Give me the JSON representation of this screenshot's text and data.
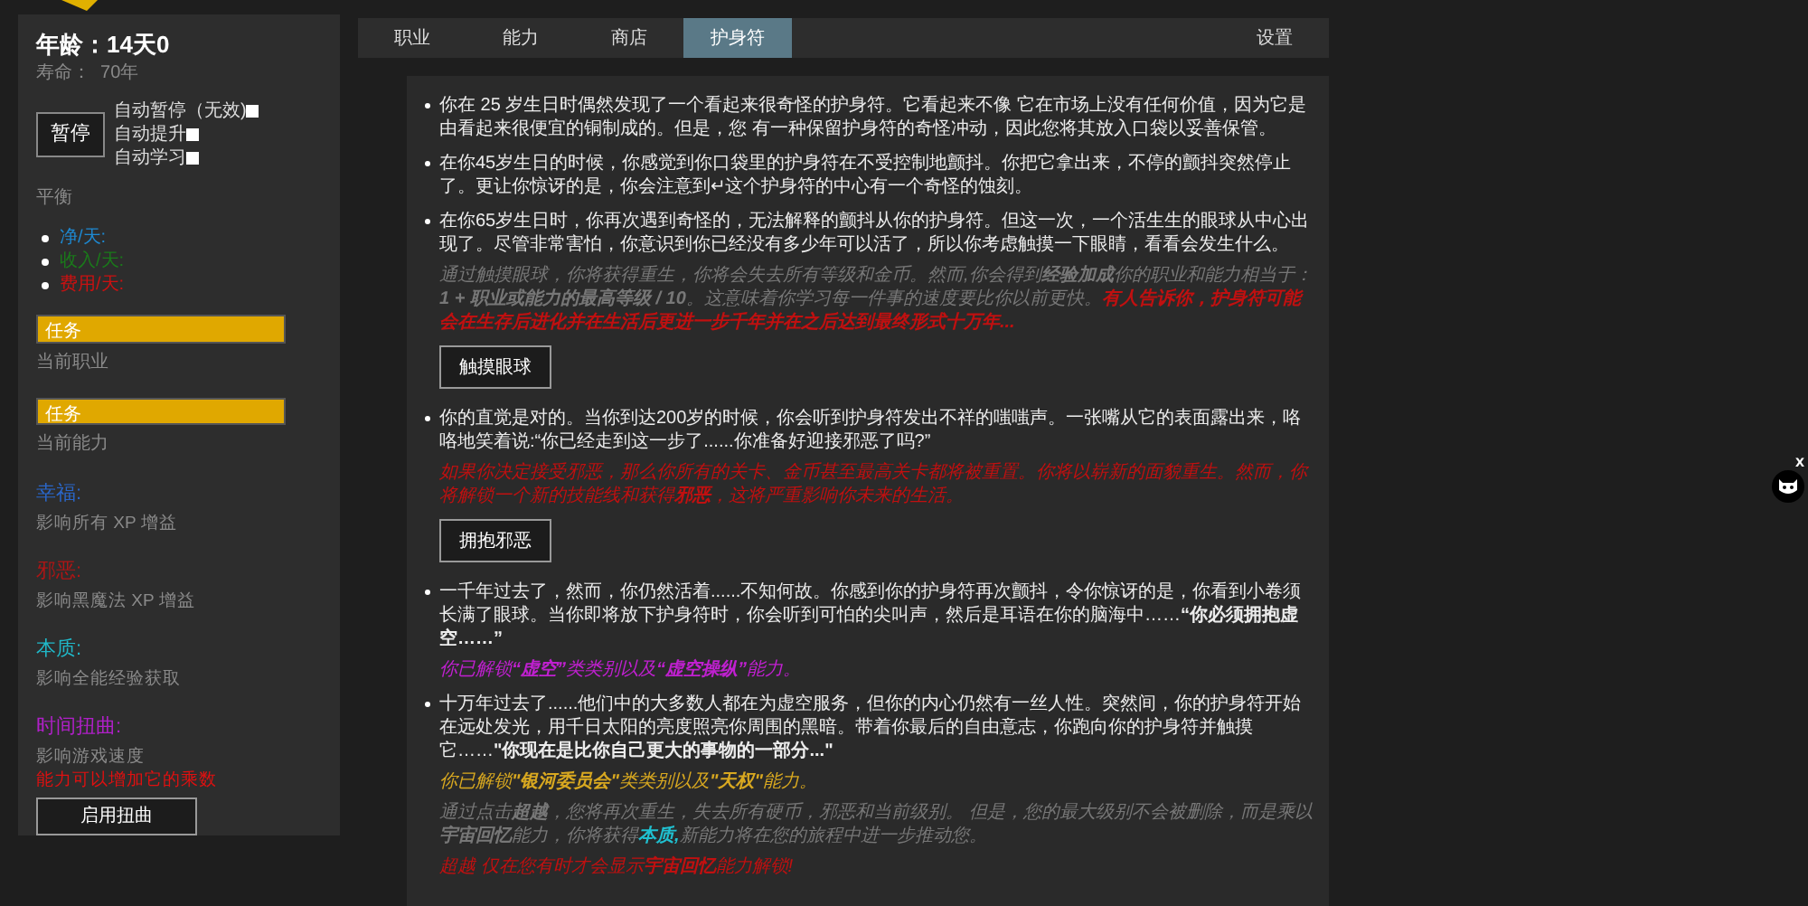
{
  "sidebar": {
    "age_label": "年龄：14天0",
    "lifespan": "寿命：  70年",
    "pause_button": "暂停",
    "toggles": [
      {
        "label": "自动暂停（无效)",
        "checked": false
      },
      {
        "label": "自动提升",
        "checked": false
      },
      {
        "label": "自动学习",
        "checked": false
      }
    ],
    "balance_label": "平衡",
    "balance_items": [
      {
        "label": "净/天:",
        "color": "#1e88d0"
      },
      {
        "label": "收入/天:",
        "color": "#1a7a1a"
      },
      {
        "label": "费用/天:",
        "color": "#cc1111"
      }
    ],
    "progress": [
      {
        "label": "任务",
        "level": 1,
        "caption": "当前职业"
      },
      {
        "label": "任务",
        "level": 1,
        "caption": "当前能力"
      }
    ],
    "stats": [
      {
        "name": "幸福:",
        "color": "#2a66c8",
        "description": "影响所有 XP 增益"
      },
      {
        "name": "邪恶:",
        "color": "#b01515",
        "description": "影响黑魔法 XP 增益"
      },
      {
        "name": "本质:",
        "color": "#20b8c8",
        "description": "影响全能经验获取"
      },
      {
        "name": "时间扭曲:",
        "color": "#b020c8",
        "description": "影响游戏速度",
        "warning": "能力可以增加它的乘数"
      }
    ],
    "warp_button": "启用扭曲"
  },
  "tabs": [
    {
      "label": "职业",
      "selected": false
    },
    {
      "label": "能力",
      "selected": false
    },
    {
      "label": "商店",
      "selected": false
    },
    {
      "label": "护身符",
      "selected": true
    }
  ],
  "settings_tab": {
    "label": "设置",
    "selected": false
  },
  "amulet_entries": [
    {
      "text": "你在 25 岁生日时偶然发现了一个看起来很奇怪的护身符。它看起来不像 它在市场上没有任何价值，因为它是由看起来很便宜的铜制成的。但是，您 有一种保留护身符的奇怪冲动，因此您将其放入口袋以妥善保管。"
    },
    {
      "text": "在你45岁生日的时候，你感觉到你口袋里的护身符在不受控制地颤抖。你把它拿出来，不停的颤抖突然停止了。更让你惊讶的是，你会注意到↵这个护身符的中心有一个奇怪的蚀刻。"
    },
    {
      "text": "在你65岁生日时，你再次遇到奇怪的，无法解释的颤抖从你的护身符。但这一次，一个活生生的眼球从中心出现了。尽管非常害怕，你意识到你已经没有多少年可以活了，所以你考虑触摸一下眼睛，看看会发生什么。",
      "notes": [
        {
          "segments": [
            {
              "kind": "muted",
              "text": "通过触摸眼球，你将获得重生，你将会失去所有等级和金币。然而,你会得到**经验加成**你的职业和能力相当于： **1 + 职业或能力的最高等级 / 10**。这意味着你学习每一件事的速度要比你以前更快。"
            },
            {
              "kind": "danger",
              "text": "**有人告诉你，护身符可能会在生存后进化并在生活后更进一步千年并在之后达到最终形式十万年...**"
            }
          ]
        }
      ],
      "button": "触摸眼球"
    },
    {
      "text": "你的直觉是对的。当你到达200岁的时候，你会听到护身符发出不祥的嗤嗤声。一张嘴从它的表面露出来，咯咯地笑着说:“你已经走到这一步了......你准备好迎接邪恶了吗?”",
      "notes": [
        {
          "segments": [
            {
              "kind": "danger",
              "text": "如果你决定接受邪恶，那么你所有的关卡、金币甚至最高关卡都将被重置。你将以崭新的面貌重生。然而，你将解锁一个新的技能线和获得**邪恶**，这将严重影响你未来的生活。"
            }
          ]
        }
      ],
      "button": "拥抱邪恶"
    },
    {
      "text": "一千年过去了，然而，你仍然活着......不知何故。你感到你的护身符再次颤抖，令你惊讶的是，你看到小卷须长满了眼球。当你即将放下护身符时，你会听到可怕的尖叫声，然后是耳语在你的脑海中……**“你必须拥抱虚空……”**",
      "notes": [
        {
          "segments": [
            {
              "kind": "void",
              "text": "你已解锁**“虚空”**类类别以及**“虚空操纵”**能力。"
            }
          ]
        }
      ]
    },
    {
      "text": "十万年过去了......他们中的大多数人都在为虚空服务，但你的内心仍然有一丝人性。突然间，你的护身符开始在远处发光，用千日太阳的亮度照亮你周围的黑暗。带着你最后的自由意志，你跑向你的护身符并触摸它……**\"你现在是比你自己更大的事物的一部分...\"**",
      "notes": [
        {
          "segments": [
            {
              "kind": "gold",
              "text": "你已解锁**\"银河委员会\"**类类别以及**\"天权\"**能力。"
            }
          ]
        },
        {
          "segments": [
            {
              "kind": "muted",
              "text": "通过点击**超越**，您将再次重生，失去所有硬币，邪恶和当前级别。 但是，您的最大级别不会被删除，而是乘以**宇宙回忆**能力，你将获得"
            },
            {
              "kind": "essence",
              "text": "**本质,**"
            },
            {
              "kind": "muted",
              "text": "新能力将在您的旅程中进一步推动您。"
            }
          ]
        },
        {
          "segments": [
            {
              "kind": "danger",
              "text": "超越 仅在您有时才会显示**宇宙回忆**能力解锁!"
            }
          ]
        }
      ]
    }
  ],
  "side_widget": {
    "close": "x"
  }
}
